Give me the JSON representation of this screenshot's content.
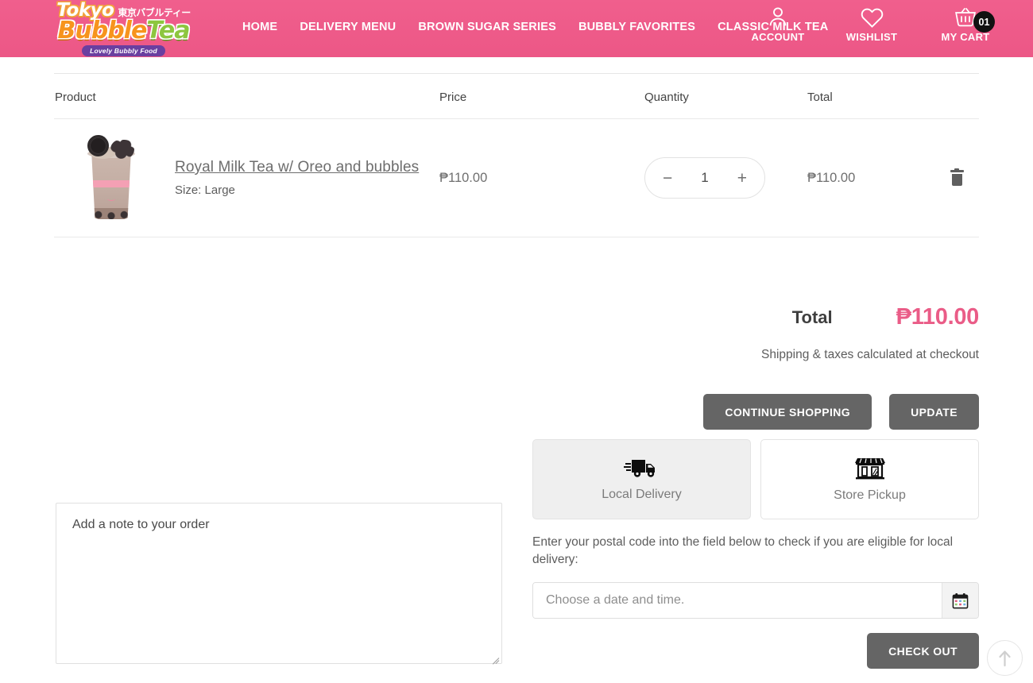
{
  "header": {
    "logo": {
      "tokyo": "Tokyo",
      "japanese": "東京バブルティー",
      "bubble": "Bubble",
      "tea": "Tea",
      "tagline": "Lovely Bubbly Food",
      "brand_pink": "#ef5f8c"
    },
    "nav": [
      {
        "label": "HOME"
      },
      {
        "label": "DELIVERY MENU"
      },
      {
        "label": "BROWN SUGAR SERIES"
      },
      {
        "label": "BUBBLY FAVORITES"
      },
      {
        "label": "CLASSIC MILK TEA"
      }
    ],
    "utils": [
      {
        "icon": "account-icon",
        "label": "ACCOUNT"
      },
      {
        "icon": "heart-icon",
        "label": "WISHLIST"
      },
      {
        "icon": "cart-icon",
        "label": "MY CART",
        "badge": "01"
      }
    ]
  },
  "cart": {
    "columns": {
      "product": "Product",
      "price": "Price",
      "quantity": "Quantity",
      "total": "Total"
    },
    "items": [
      {
        "title": "Royal Milk Tea w/ Oreo and bubbles",
        "variant": "Size: Large",
        "price": "₱110.00",
        "quantity": "1",
        "line_total": "₱110.00",
        "decrease_label": "−",
        "increase_label": "+",
        "remove_icon": "trash-icon"
      }
    ]
  },
  "summary": {
    "total_label": "Total",
    "total_value": "₱110.00",
    "total_color": "#ea5c87",
    "note": "Shipping & taxes calculated at checkout",
    "continue_label": "CONTINUE SHOPPING",
    "update_label": "UPDATE"
  },
  "order_note": {
    "placeholder": "Add a note to your order",
    "value": ""
  },
  "delivery": {
    "tabs": [
      {
        "label": "Local Delivery",
        "icon": "delivery-truck-icon",
        "glyph": "🚚",
        "active": true
      },
      {
        "label": "Store Pickup",
        "icon": "storefront-icon",
        "glyph": "🏪",
        "active": false
      }
    ],
    "help_text": "Enter your postal code into the field below to check if you are eligible for local delivery:",
    "date_placeholder": "Choose a date and time.",
    "date_value": "",
    "calendar_icon": "calendar-icon",
    "calendar_glyph": "📅",
    "checkout_label": "CHECK OUT"
  },
  "scroll_top": {
    "icon": "arrow-up-icon"
  }
}
